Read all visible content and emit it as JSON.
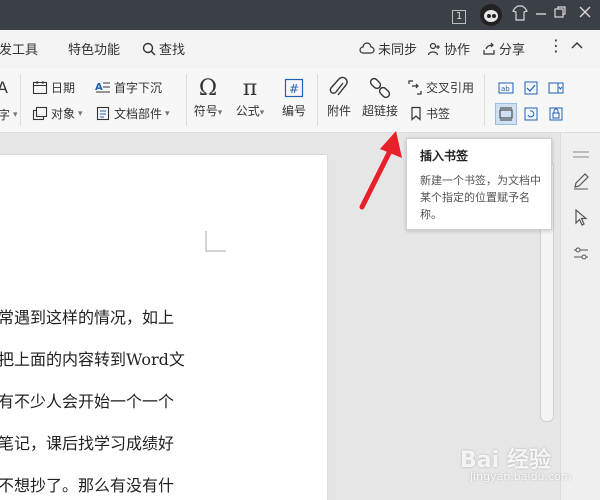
{
  "titlebar": {
    "page_indicator": "1",
    "icons": [
      "window-restore-icon",
      "avatar",
      "shirt-icon",
      "minimize-icon",
      "restore-icon",
      "close-icon"
    ]
  },
  "menubar": {
    "partial_tab": "开发工具",
    "special": "特色功能",
    "search": "查找",
    "unsync": "未同步",
    "collab": "协作",
    "share": "分享"
  },
  "ribbon": {
    "date": "日期",
    "first_char": "首字下沉",
    "object": "对象",
    "doc_parts": "文档部件",
    "symbol": "符号",
    "formula": "公式",
    "numbering": "编号",
    "attachment": "附件",
    "hyperlink": "超链接",
    "cross_ref": "交叉引用",
    "bookmark": "书签",
    "partial_left_top": "A",
    "partial_left_bottom": "字"
  },
  "tooltip": {
    "title": "插入书签",
    "body": "新建一个书签，为文档中某个指定的位置赋予名称。"
  },
  "document": {
    "lines": [
      "常遇到这样的情况，如上",
      "把上面的内容转到Word文",
      "有不少人会开始一个一个",
      "笔记，课后找学习成绩好",
      "不想抄了。那么有没有什"
    ]
  },
  "watermark": {
    "brand": "Bai 经验",
    "sub": "jingyan.baidu.com"
  },
  "colors": {
    "titlebar": "#3b3f46",
    "arrow": "#e8202a",
    "highlight": "#dfe8f3"
  }
}
